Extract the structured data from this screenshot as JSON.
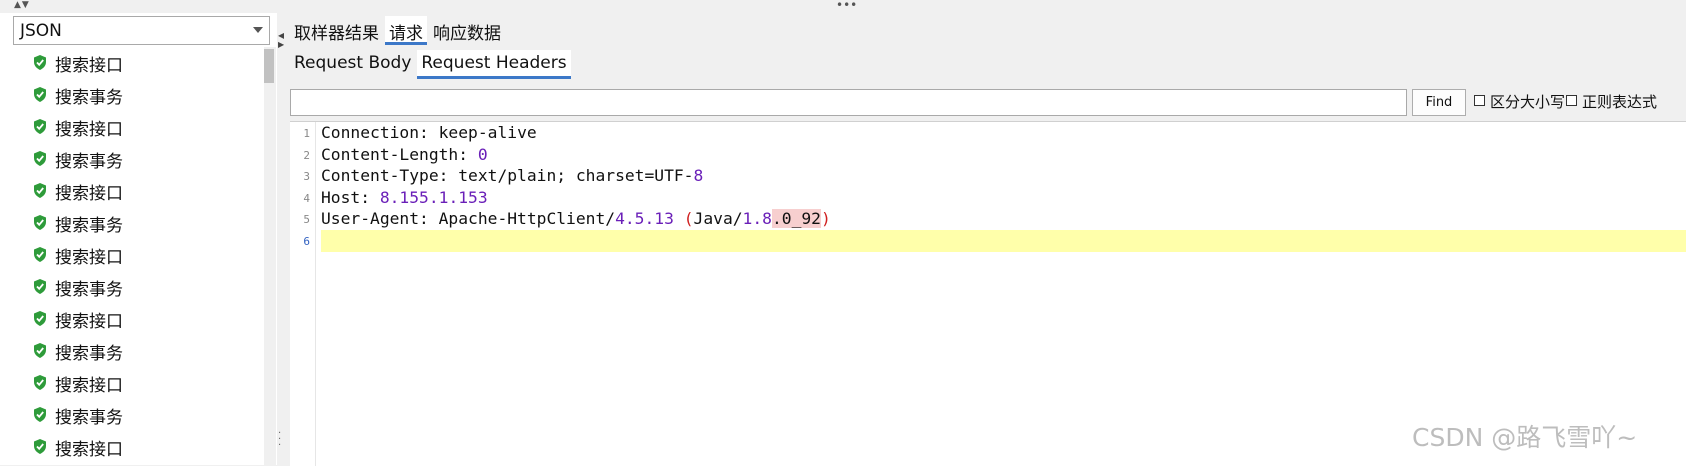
{
  "left": {
    "format_select": "JSON",
    "items": [
      "搜索接口",
      "搜索事务",
      "搜索接口",
      "搜索事务",
      "搜索接口",
      "搜索事务",
      "搜索接口",
      "搜索事务",
      "搜索接口",
      "搜索事务",
      "搜索接口",
      "搜索事务",
      "搜索接口"
    ]
  },
  "tabs": [
    {
      "label": "取样器结果",
      "active": false
    },
    {
      "label": "请求",
      "active": true
    },
    {
      "label": "响应数据",
      "active": false
    }
  ],
  "subtabs": [
    {
      "label": "Request Body",
      "active": false
    },
    {
      "label": "Request Headers",
      "active": true
    }
  ],
  "search": {
    "value": "",
    "find_label": "Find",
    "case_label": "区分大小写",
    "regex_label": "正则表达式"
  },
  "editor": {
    "line_numbers": [
      "1",
      "2",
      "3",
      "4",
      "5",
      "6"
    ],
    "lines": [
      [
        {
          "t": "Connection: keep"
        },
        {
          "t": "-"
        },
        {
          "t": "alive"
        }
      ],
      [
        {
          "t": "Content-Length: "
        },
        {
          "t": "0",
          "c": "num"
        }
      ],
      [
        {
          "t": "Content-Type: text/plain; charset=UTF-"
        },
        {
          "t": "8",
          "c": "num"
        }
      ],
      [
        {
          "t": "Host: "
        },
        {
          "t": "8.155.1.153",
          "c": "num"
        }
      ],
      [
        {
          "t": "User-Agent: Apache-HttpClient/"
        },
        {
          "t": "4.5.13",
          "c": "num"
        },
        {
          "t": " "
        },
        {
          "t": "(",
          "c": "paren"
        },
        {
          "t": "Java/"
        },
        {
          "t": "1.8",
          "c": "num"
        },
        {
          "t": ".0_92",
          "c": "hl"
        },
        {
          "t": ")",
          "c": "paren"
        }
      ],
      []
    ]
  },
  "watermark": "CSDN @路飞雪吖~",
  "colors": {
    "accent": "#3c78c8",
    "current_line": "#ffffaa",
    "number": "#6a1fb8",
    "paren": "#d02020",
    "highlight": "#f7cfcf"
  }
}
